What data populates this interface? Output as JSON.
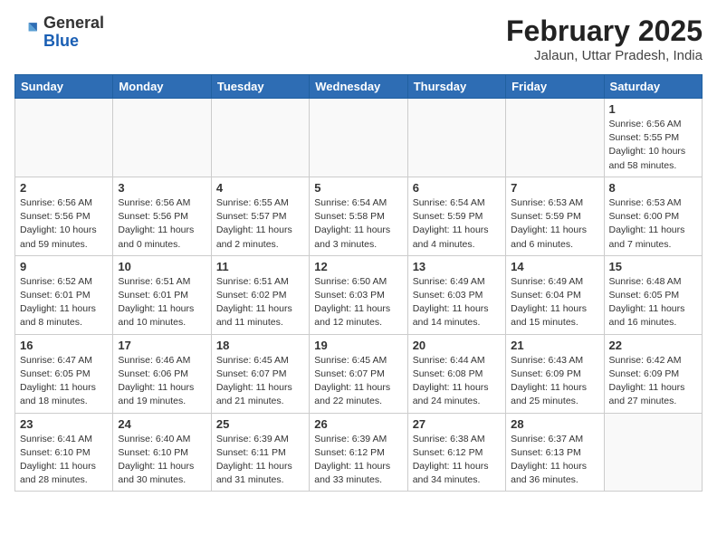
{
  "header": {
    "logo_general": "General",
    "logo_blue": "Blue",
    "month_title": "February 2025",
    "subtitle": "Jalaun, Uttar Pradesh, India"
  },
  "days_of_week": [
    "Sunday",
    "Monday",
    "Tuesday",
    "Wednesday",
    "Thursday",
    "Friday",
    "Saturday"
  ],
  "weeks": [
    [
      {
        "day": "",
        "info": ""
      },
      {
        "day": "",
        "info": ""
      },
      {
        "day": "",
        "info": ""
      },
      {
        "day": "",
        "info": ""
      },
      {
        "day": "",
        "info": ""
      },
      {
        "day": "",
        "info": ""
      },
      {
        "day": "1",
        "info": "Sunrise: 6:56 AM\nSunset: 5:55 PM\nDaylight: 10 hours\nand 58 minutes."
      }
    ],
    [
      {
        "day": "2",
        "info": "Sunrise: 6:56 AM\nSunset: 5:56 PM\nDaylight: 10 hours\nand 59 minutes."
      },
      {
        "day": "3",
        "info": "Sunrise: 6:56 AM\nSunset: 5:56 PM\nDaylight: 11 hours\nand 0 minutes."
      },
      {
        "day": "4",
        "info": "Sunrise: 6:55 AM\nSunset: 5:57 PM\nDaylight: 11 hours\nand 2 minutes."
      },
      {
        "day": "5",
        "info": "Sunrise: 6:54 AM\nSunset: 5:58 PM\nDaylight: 11 hours\nand 3 minutes."
      },
      {
        "day": "6",
        "info": "Sunrise: 6:54 AM\nSunset: 5:59 PM\nDaylight: 11 hours\nand 4 minutes."
      },
      {
        "day": "7",
        "info": "Sunrise: 6:53 AM\nSunset: 5:59 PM\nDaylight: 11 hours\nand 6 minutes."
      },
      {
        "day": "8",
        "info": "Sunrise: 6:53 AM\nSunset: 6:00 PM\nDaylight: 11 hours\nand 7 minutes."
      }
    ],
    [
      {
        "day": "9",
        "info": "Sunrise: 6:52 AM\nSunset: 6:01 PM\nDaylight: 11 hours\nand 8 minutes."
      },
      {
        "day": "10",
        "info": "Sunrise: 6:51 AM\nSunset: 6:01 PM\nDaylight: 11 hours\nand 10 minutes."
      },
      {
        "day": "11",
        "info": "Sunrise: 6:51 AM\nSunset: 6:02 PM\nDaylight: 11 hours\nand 11 minutes."
      },
      {
        "day": "12",
        "info": "Sunrise: 6:50 AM\nSunset: 6:03 PM\nDaylight: 11 hours\nand 12 minutes."
      },
      {
        "day": "13",
        "info": "Sunrise: 6:49 AM\nSunset: 6:03 PM\nDaylight: 11 hours\nand 14 minutes."
      },
      {
        "day": "14",
        "info": "Sunrise: 6:49 AM\nSunset: 6:04 PM\nDaylight: 11 hours\nand 15 minutes."
      },
      {
        "day": "15",
        "info": "Sunrise: 6:48 AM\nSunset: 6:05 PM\nDaylight: 11 hours\nand 16 minutes."
      }
    ],
    [
      {
        "day": "16",
        "info": "Sunrise: 6:47 AM\nSunset: 6:05 PM\nDaylight: 11 hours\nand 18 minutes."
      },
      {
        "day": "17",
        "info": "Sunrise: 6:46 AM\nSunset: 6:06 PM\nDaylight: 11 hours\nand 19 minutes."
      },
      {
        "day": "18",
        "info": "Sunrise: 6:45 AM\nSunset: 6:07 PM\nDaylight: 11 hours\nand 21 minutes."
      },
      {
        "day": "19",
        "info": "Sunrise: 6:45 AM\nSunset: 6:07 PM\nDaylight: 11 hours\nand 22 minutes."
      },
      {
        "day": "20",
        "info": "Sunrise: 6:44 AM\nSunset: 6:08 PM\nDaylight: 11 hours\nand 24 minutes."
      },
      {
        "day": "21",
        "info": "Sunrise: 6:43 AM\nSunset: 6:09 PM\nDaylight: 11 hours\nand 25 minutes."
      },
      {
        "day": "22",
        "info": "Sunrise: 6:42 AM\nSunset: 6:09 PM\nDaylight: 11 hours\nand 27 minutes."
      }
    ],
    [
      {
        "day": "23",
        "info": "Sunrise: 6:41 AM\nSunset: 6:10 PM\nDaylight: 11 hours\nand 28 minutes."
      },
      {
        "day": "24",
        "info": "Sunrise: 6:40 AM\nSunset: 6:10 PM\nDaylight: 11 hours\nand 30 minutes."
      },
      {
        "day": "25",
        "info": "Sunrise: 6:39 AM\nSunset: 6:11 PM\nDaylight: 11 hours\nand 31 minutes."
      },
      {
        "day": "26",
        "info": "Sunrise: 6:39 AM\nSunset: 6:12 PM\nDaylight: 11 hours\nand 33 minutes."
      },
      {
        "day": "27",
        "info": "Sunrise: 6:38 AM\nSunset: 6:12 PM\nDaylight: 11 hours\nand 34 minutes."
      },
      {
        "day": "28",
        "info": "Sunrise: 6:37 AM\nSunset: 6:13 PM\nDaylight: 11 hours\nand 36 minutes."
      },
      {
        "day": "",
        "info": ""
      }
    ]
  ]
}
